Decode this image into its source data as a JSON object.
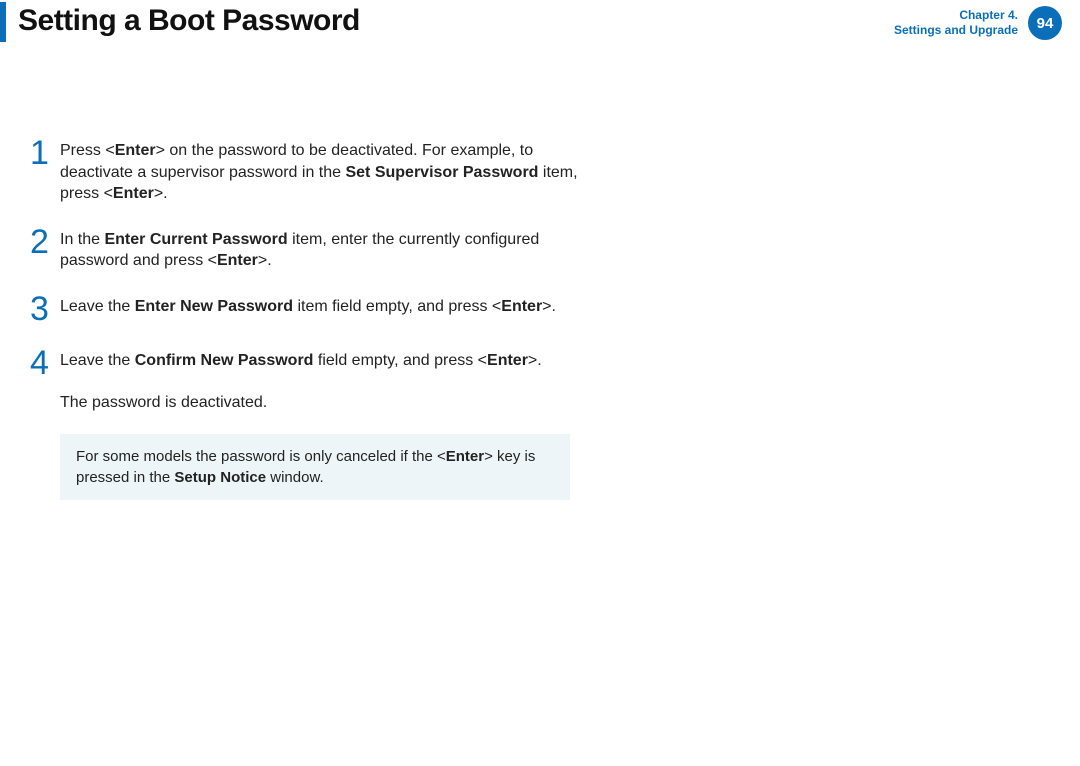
{
  "header": {
    "title": "Setting a Boot Password",
    "chapter_line1": "Chapter 4.",
    "chapter_line2": "Settings and Upgrade",
    "page_number": "94"
  },
  "steps": [
    {
      "num": "1",
      "html": "Press <<b>Enter</b>> on the password to be deactivated. For example, to deactivate a supervisor password in the <b>Set Supervisor Password</b> item, press <<b>Enter</b>>."
    },
    {
      "num": "2",
      "html": "In the <b>Enter Current Password</b> item, enter the currently conﬁgured password and press <<b>Enter</b>>."
    },
    {
      "num": "3",
      "html": "Leave the <b>Enter New Password</b> item ﬁeld empty, and press <<b>Enter</b>>."
    },
    {
      "num": "4",
      "html": "Leave the <b>Conﬁrm New Password</b> ﬁeld empty, and press <<b>Enter</b>>."
    }
  ],
  "result": "The password is deactivated.",
  "note": "For some models the password is only canceled if the <<b>Enter</b>> key is pressed in the <b>Setup Notice</b> window."
}
